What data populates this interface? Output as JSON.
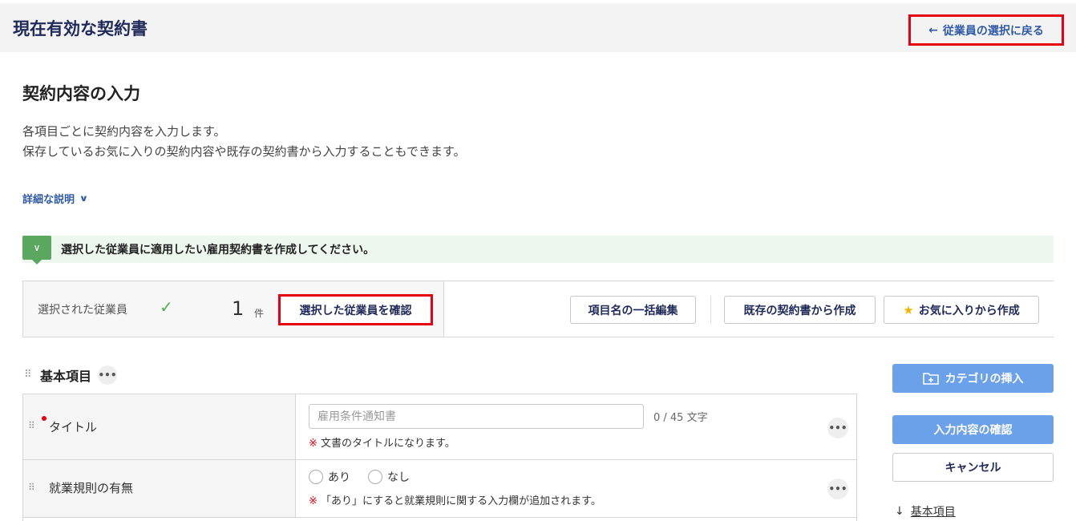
{
  "header": {
    "title": "現在有効な契約書",
    "back_link": "従業員の選択に戻る"
  },
  "main": {
    "heading": "契約内容の入力",
    "description": [
      "各項目ごとに契約内容を入力します。",
      "保存しているお気に入りの契約内容や既存の契約書から入力することもできます。"
    ],
    "details_toggle": "詳細な説明"
  },
  "notice": {
    "text": "選択した従業員に適用したい雇用契約書を作成してください。"
  },
  "selection": {
    "label": "選択された従業員",
    "count": "1",
    "unit": "件",
    "confirm_button": "選択した従業員を確認",
    "bulk_edit_button": "項目名の一括編集",
    "from_existing_button": "既存の契約書から作成",
    "from_favorites_button": "お気に入りから作成"
  },
  "section": {
    "title": "基本項目"
  },
  "rows": [
    {
      "label": "タイトル",
      "required": true,
      "input_placeholder": "雇用条件通知書",
      "char_count": "0 / 45 文字",
      "hint_mark": "※",
      "hint": "文書のタイトルになります。"
    },
    {
      "label": "就業規則の有無",
      "required": false,
      "options": [
        "あり",
        "なし"
      ],
      "hint_mark": "※",
      "hint": "「あり」にすると就業規則に関する入力欄が追加されます。"
    }
  ],
  "sidebar": {
    "insert_category": "カテゴリの挿入",
    "confirm_input": "入力内容の確認",
    "cancel": "キャンセル",
    "jump_link": "基本項目"
  },
  "colors": {
    "accent_blue": "#6ba1ea",
    "link_blue": "#2f5aa8",
    "highlight_red": "#e60012",
    "notice_green": "#5aa75f"
  }
}
